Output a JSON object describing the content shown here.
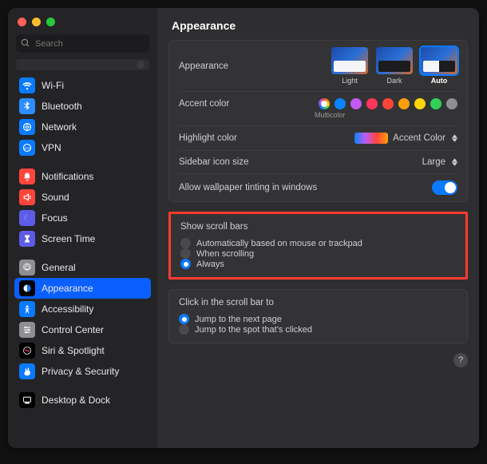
{
  "title": "Appearance",
  "search": {
    "placeholder": "Search"
  },
  "sidebar": {
    "items": [
      {
        "label": "Wi-Fi",
        "iconClass": "ic-blue",
        "icon": "wifi"
      },
      {
        "label": "Bluetooth",
        "iconClass": "ic-lblue",
        "icon": "bluetooth"
      },
      {
        "label": "Network",
        "iconClass": "ic-net",
        "icon": "globe"
      },
      {
        "label": "VPN",
        "iconClass": "ic-blue",
        "icon": "vpn"
      },
      {
        "gap": true
      },
      {
        "label": "Notifications",
        "iconClass": "ic-red",
        "icon": "bell"
      },
      {
        "label": "Sound",
        "iconClass": "ic-red",
        "icon": "sound"
      },
      {
        "label": "Focus",
        "iconClass": "ic-indigo",
        "icon": "moon"
      },
      {
        "label": "Screen Time",
        "iconClass": "ic-indigo",
        "icon": "hourglass"
      },
      {
        "gap": true
      },
      {
        "label": "General",
        "iconClass": "ic-gray",
        "icon": "gear"
      },
      {
        "label": "Appearance",
        "iconClass": "ic-black",
        "icon": "appear",
        "selected": true
      },
      {
        "label": "Accessibility",
        "iconClass": "ic-blue",
        "icon": "access"
      },
      {
        "label": "Control Center",
        "iconClass": "ic-gray",
        "icon": "sliders"
      },
      {
        "label": "Siri & Spotlight",
        "iconClass": "ic-black",
        "icon": "siri"
      },
      {
        "label": "Privacy & Security",
        "iconClass": "ic-blue",
        "icon": "hand"
      },
      {
        "gap": true
      },
      {
        "label": "Desktop & Dock",
        "iconClass": "ic-black",
        "icon": "dock"
      }
    ]
  },
  "appearance": {
    "label": "Appearance",
    "options": [
      {
        "name": "Light",
        "thumb": "light"
      },
      {
        "name": "Dark",
        "thumb": "dark"
      },
      {
        "name": "Auto",
        "thumb": "auto",
        "selected": true
      }
    ]
  },
  "accent": {
    "label": "Accent color",
    "multicolor_label": "Multicolor",
    "colors": [
      {
        "name": "multicolor",
        "class": "multi",
        "selected": true
      },
      {
        "name": "blue",
        "hex": "#0a84ff"
      },
      {
        "name": "purple",
        "hex": "#bf5af2"
      },
      {
        "name": "pink",
        "hex": "#ff375f"
      },
      {
        "name": "red",
        "hex": "#ff453a"
      },
      {
        "name": "orange",
        "hex": "#ff9f0a"
      },
      {
        "name": "yellow",
        "hex": "#ffd60a"
      },
      {
        "name": "green",
        "hex": "#30d158"
      },
      {
        "name": "graphite",
        "hex": "#8e8e93"
      }
    ]
  },
  "highlight": {
    "label": "Highlight color",
    "value": "Accent Color"
  },
  "sidebar_size": {
    "label": "Sidebar icon size",
    "value": "Large"
  },
  "tinting": {
    "label": "Allow wallpaper tinting in windows",
    "on": true
  },
  "scrollbars": {
    "label": "Show scroll bars",
    "options": [
      {
        "label": "Automatically based on mouse or trackpad"
      },
      {
        "label": "When scrolling"
      },
      {
        "label": "Always",
        "selected": true
      }
    ]
  },
  "scrollclick": {
    "label": "Click in the scroll bar to",
    "options": [
      {
        "label": "Jump to the next page",
        "selected": true
      },
      {
        "label": "Jump to the spot that's clicked"
      }
    ]
  },
  "help": "?"
}
